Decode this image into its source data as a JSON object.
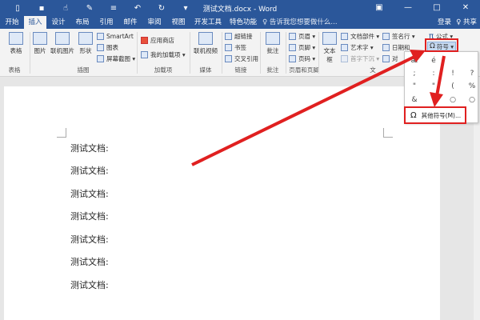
{
  "title_bar": {
    "document_title": "测试文档.docx - Word",
    "qat_icons": [
      "file-icon",
      "save-icon",
      "touch-mode-icon",
      "format-painter-icon",
      "list-icon",
      "undo-icon",
      "redo-icon",
      "customize-icon"
    ],
    "window_icons": [
      "ribbon-display-icon",
      "minimize-icon",
      "maximize-icon",
      "close-icon"
    ]
  },
  "tabs": [
    "开始",
    "插入",
    "设计",
    "布局",
    "引用",
    "邮件",
    "审阅",
    "视图",
    "开发工具",
    "特色功能"
  ],
  "active_tab": "插入",
  "tell_me": "♀ 告诉我您想要做什么...",
  "login": "登录",
  "share": "♀ 共享",
  "ribbon": {
    "groups": [
      "表格",
      "插图",
      "加载项",
      "媒体",
      "链接",
      "批注",
      "页眉和页脚"
    ],
    "buttons": {
      "table": "表格",
      "picture": "图片",
      "online_picture": "联机图片",
      "shapes": "形状",
      "smartart": "SmartArt",
      "chart": "图表",
      "screenshot": "屏幕截图 ▾",
      "store": "应用商店",
      "my_addins": "我的加载项 ▾",
      "online_video": "联机视频",
      "hyperlink": "超链接",
      "bookmark": "书签",
      "cross_ref": "交叉引用",
      "comment": "批注",
      "header": "页眉 ▾",
      "footer": "页脚 ▾",
      "page_number": "页码 ▾",
      "text_box": "文本框",
      "quick_parts": "文档部件 ▾",
      "wordart": "艺术字 ▾",
      "drop_cap": "首字下沉 ▾",
      "signature": "签名行 ▾",
      "date_time": "日期和",
      "object": "对",
      "equation": "公式 ▾",
      "symbol": "符号 ▾",
      "text_group_partial": "文"
    }
  },
  "symbol_dropdown": {
    "symbols": [
      "æ",
      "é",
      "",
      "",
      "",
      ";",
      ":",
      "!",
      "?",
      "\"",
      "\"",
      "(",
      "",
      ")",
      "%",
      "&",
      "]",
      "",
      "○",
      "○"
    ],
    "more_symbols": "其他符号(M)..."
  },
  "document": {
    "lines": [
      "测试文档:",
      "测试文档:",
      "测试文档:",
      "测试文档:",
      "测试文档:",
      "测试文档:",
      "测试文档:"
    ]
  },
  "colors": {
    "word_blue": "#2b579a",
    "annotation_red": "#e02020"
  }
}
